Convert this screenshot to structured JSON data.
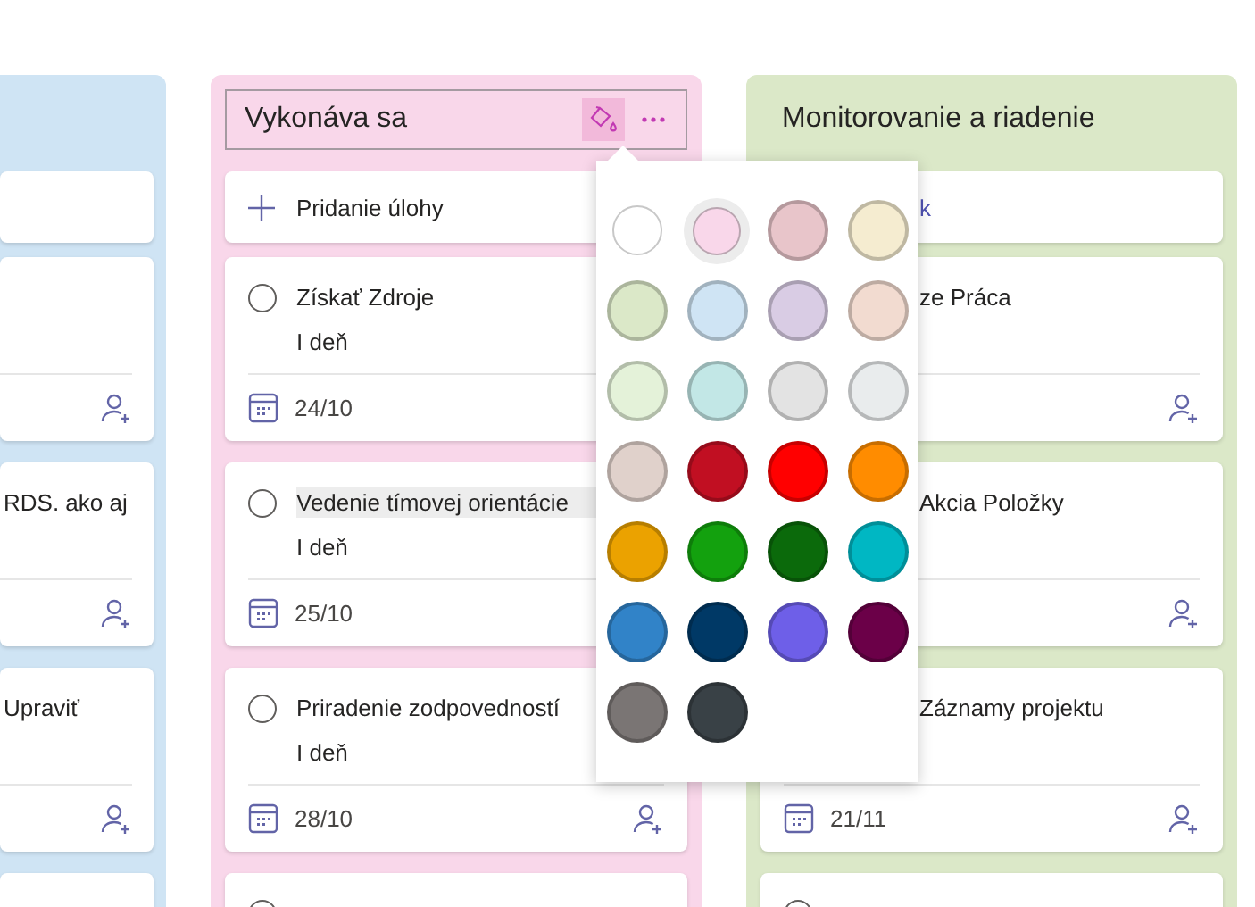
{
  "columns": [
    {
      "kind": "cut",
      "color": "#cfe4f4",
      "cards": [
        {
          "title": "RDS. ako aj"
        },
        {
          "title": "Upraviť"
        }
      ]
    },
    {
      "kind": "full",
      "color": "#f9d7ea",
      "header": {
        "title": "Vykonáva sa",
        "tools": true
      },
      "add_task": {
        "label": "Pridanie úlohy"
      },
      "cards": [
        {
          "title": "Získať  Zdroje",
          "duration": "I deň",
          "date": "24/10",
          "completed": false
        },
        {
          "title": "Vedenie tímovej orientácie",
          "highlighted": true,
          "duration": "I deň",
          "date": "25/10",
          "completed": false
        },
        {
          "title": "Priradenie zodpovedností",
          "duration": "I deň",
          "date": "28/10",
          "completed": false
        },
        {
          "completed": false
        }
      ]
    },
    {
      "kind": "covered",
      "color": "#dbe8c8",
      "header": {
        "title": "Monitorovanie a riadenie"
      },
      "add_task": {
        "label": "k"
      },
      "cards": [
        {
          "title": "ze Práca"
        },
        {
          "title": "Akcia  Položky"
        },
        {
          "title": "Záznamy projektu",
          "date": "21/11"
        },
        {
          "completed": false
        }
      ]
    }
  ],
  "color_picker": {
    "swatches": [
      {
        "color": "#ffffff",
        "selected": false
      },
      {
        "color": "#f9d7ea",
        "selected": true
      },
      {
        "color": "#e8c5ca",
        "selected": false
      },
      {
        "color": "#f5ecd0",
        "selected": false
      },
      {
        "color": "#dbe8c8",
        "selected": false
      },
      {
        "color": "#cfe4f4",
        "selected": false
      },
      {
        "color": "#d9cce4",
        "selected": false
      },
      {
        "color": "#f2dbd0",
        "selected": false
      },
      {
        "color": "#e4f2d9",
        "selected": false
      },
      {
        "color": "#c2e7e6",
        "selected": false
      },
      {
        "color": "#e3e3e3",
        "selected": false
      },
      {
        "color": "#e9eced",
        "selected": false
      },
      {
        "color": "#e0d1cb",
        "selected": false
      },
      {
        "color": "#c10f22",
        "selected": false
      },
      {
        "color": "#ff0000",
        "selected": false
      },
      {
        "color": "#ff8c00",
        "selected": false
      },
      {
        "color": "#eba200",
        "selected": false
      },
      {
        "color": "#13a10e",
        "selected": false
      },
      {
        "color": "#0b6a0b",
        "selected": false
      },
      {
        "color": "#00b7c3",
        "selected": false
      },
      {
        "color": "#3183c8",
        "selected": false
      },
      {
        "color": "#003966",
        "selected": false
      },
      {
        "color": "#6e5fe8",
        "selected": false
      },
      {
        "color": "#6b0048",
        "selected": false
      },
      {
        "color": "#7a7574",
        "selected": false
      },
      {
        "color": "#394146",
        "selected": false
      }
    ]
  }
}
